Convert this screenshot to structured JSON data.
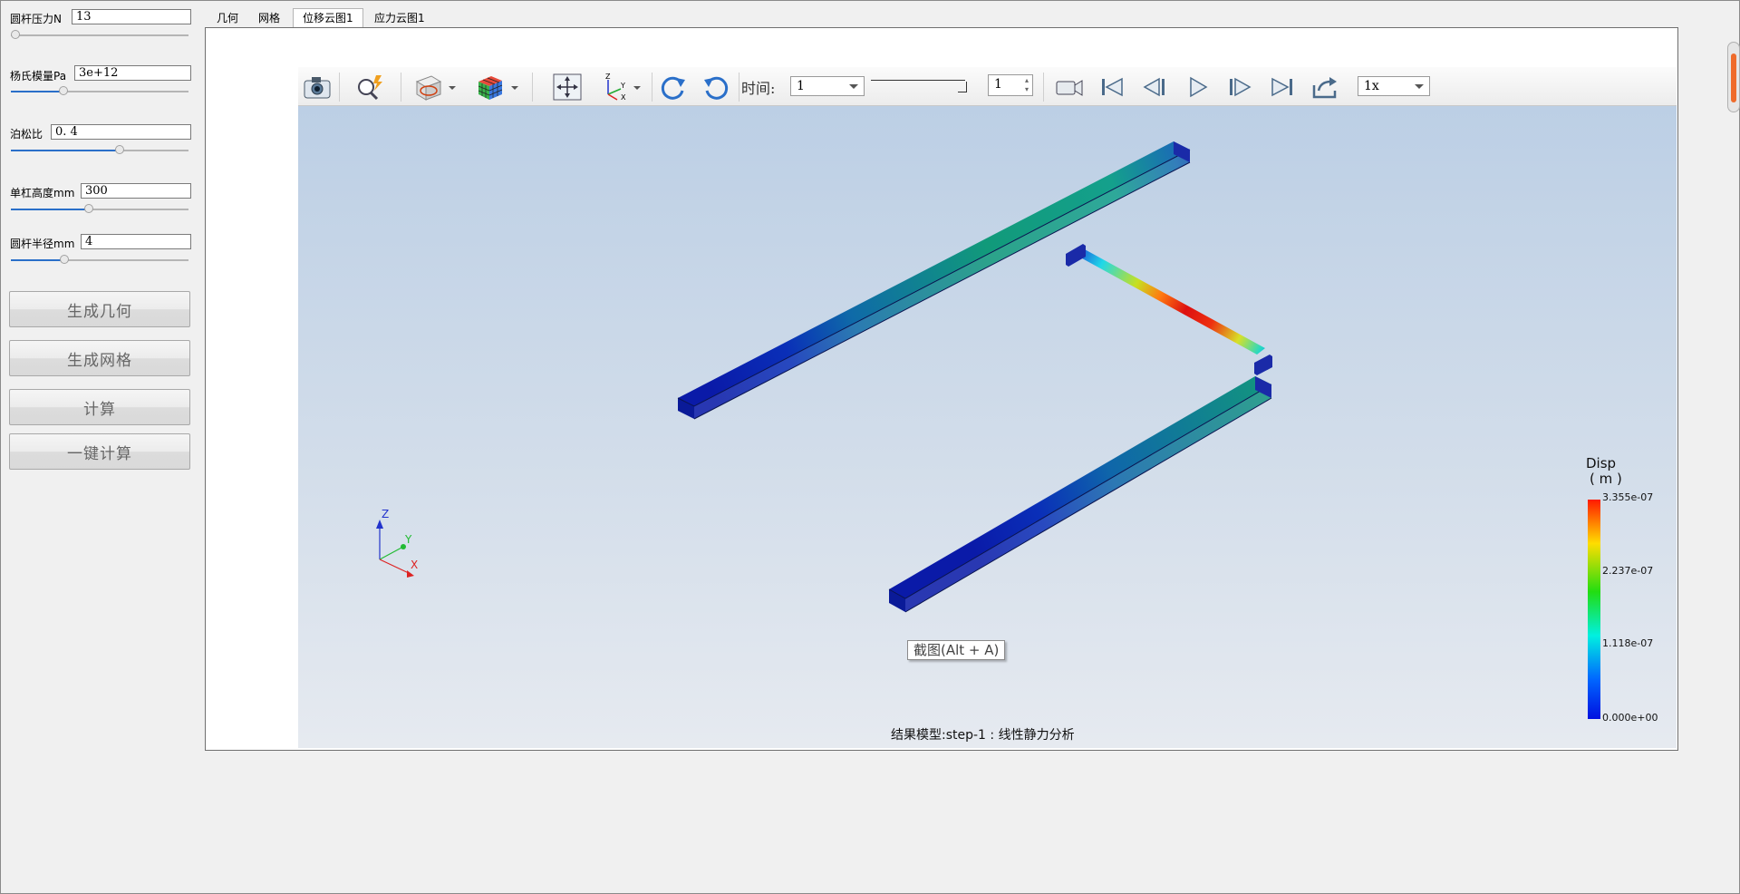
{
  "params": [
    {
      "label": "圆杆压力N",
      "value": "13",
      "slider": 0.0
    },
    {
      "label": "杨氏模量Pa",
      "value": "3e+12",
      "slider": 0.25
    },
    {
      "label": "泊松比",
      "value": "0. 4",
      "slider": 0.6
    },
    {
      "label": "单杠高度mm",
      "value": "300",
      "slider": 0.42
    },
    {
      "label": "圆杆半径mm",
      "value": "4",
      "slider": 0.28
    }
  ],
  "buttons": {
    "geometry": "生成几何",
    "mesh": "生成网格",
    "compute": "计算",
    "one_click": "一键计算"
  },
  "tabs": [
    "几何",
    "网格",
    "位移云图1",
    "应力云图1"
  ],
  "active_tab": "位移云图1",
  "toolbar": {
    "time_label": "时间:",
    "time_value": "1",
    "frame_value": "1",
    "speed_value": "1x",
    "icons": [
      "camera-icon",
      "zoom-probe-icon",
      "clip-view-icon",
      "color-cube-icon",
      "fit-view-icon",
      "axes-icon",
      "rotate-cw-icon",
      "rotate-ccw-icon",
      "record-icon",
      "first-frame-icon",
      "prev-frame-icon",
      "play-icon",
      "next-frame-icon",
      "last-frame-icon",
      "export-icon"
    ]
  },
  "tooltip": "截图(Alt + A)",
  "status": "结果模型:step-1 : 线性静力分析",
  "legend": {
    "title_line1": "Disp",
    "title_line2": "( m )",
    "ticks": [
      "3.355e-07",
      "2.237e-07",
      "1.118e-07",
      "0.000e+00"
    ],
    "max": 3.355e-07,
    "min": 0.0
  },
  "axes": {
    "z": "Z",
    "y": "Y",
    "x": "X"
  },
  "colors": {
    "accent": "#2a6fc9",
    "viewport_top": "#bccfe5",
    "viewport_bottom": "#e6eaf0",
    "scroll_thumb": "#ef6b2b"
  }
}
